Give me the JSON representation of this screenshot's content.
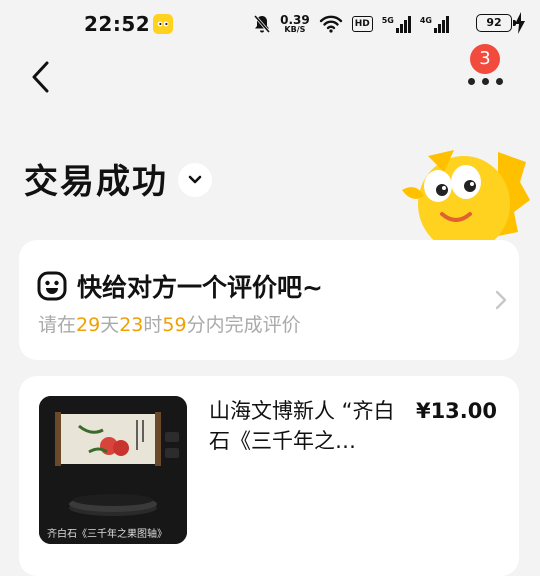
{
  "status_bar": {
    "time": "22:52",
    "app_icon": "xianyu-app-icon",
    "speed_value": "0.39",
    "speed_unit": "KB/S",
    "hd_label": "HD",
    "net1": "5G",
    "net2": "4G",
    "battery": "92",
    "icons": [
      "mute-bell-icon",
      "wifi-icon",
      "signal-icon",
      "battery-icon",
      "charging-icon"
    ]
  },
  "nav": {
    "back_icon": "chevron-left-icon",
    "more_icon": "more-dots-icon",
    "badge_count": "3"
  },
  "page": {
    "title": "交易成功",
    "toggle_icon": "chevron-down-icon"
  },
  "review": {
    "title": "快给对方一个评价吧~",
    "prefix": "请在",
    "days": "29",
    "days_unit": "天",
    "hours": "23",
    "hours_unit": "时",
    "minutes": "59",
    "minutes_unit": "分内完成评价",
    "icon": "smiley-face-icon",
    "chevron_icon": "chevron-right-icon"
  },
  "order": {
    "product_title": "山海文博新人 “齐白石《三千年之…",
    "price": "¥13.00",
    "thumb_caption": "齐白石《三千年之果图轴》"
  },
  "colors": {
    "background": "#f3f3f3",
    "card": "#ffffff",
    "accent_orange": "#f0a000",
    "badge_red": "#f24a3d",
    "mascot_yellow": "#ffd21f"
  }
}
